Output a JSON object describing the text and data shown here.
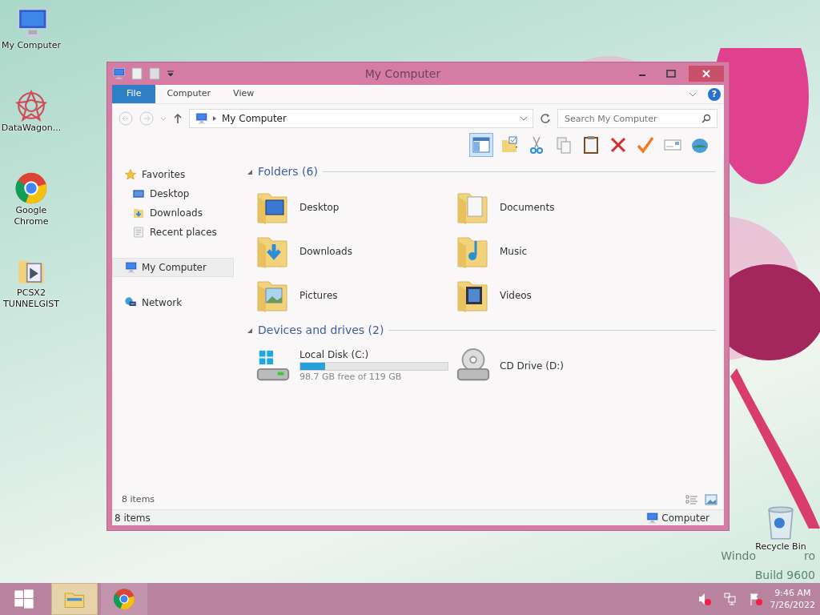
{
  "desktop_icons": [
    {
      "label": "My Computer",
      "kind": "computer"
    },
    {
      "label": "DataWagon...",
      "kind": "app"
    },
    {
      "label": "Google Chrome",
      "kind": "chrome"
    },
    {
      "label": "PCSX2 TUNNELGIST",
      "kind": "folder"
    }
  ],
  "recycle_bin": {
    "label": "Recycle Bin"
  },
  "os_watermark": {
    "line_1_left": "Windo",
    "line_1_right": "ro",
    "line_2": "Build 9600"
  },
  "window": {
    "title": "My Computer",
    "ribbon_tabs": [
      {
        "label": "File",
        "kind": "file"
      },
      {
        "label": "Computer",
        "kind": "tab"
      },
      {
        "label": "View",
        "kind": "tab"
      }
    ],
    "help_button": "?",
    "address": "My Computer",
    "search": {
      "placeholder": "Search My Computer"
    },
    "nav": [
      {
        "label": "Favorites",
        "kind": "star",
        "selected": false,
        "children": [
          {
            "label": "Desktop",
            "kind": "desktop",
            "selected": false
          },
          {
            "label": "Downloads",
            "kind": "downloads",
            "selected": false
          },
          {
            "label": "Recent places",
            "kind": "recent",
            "selected": false
          }
        ]
      },
      {
        "label": "My Computer",
        "kind": "computer",
        "selected": true
      },
      {
        "label": "Network",
        "kind": "network",
        "selected": false
      }
    ],
    "sections": [
      {
        "title": "Folders (6)",
        "items": [
          {
            "label": "Desktop",
            "kind": "desktop"
          },
          {
            "label": "Documents",
            "kind": "documents"
          },
          {
            "label": "Downloads",
            "kind": "downloads"
          },
          {
            "label": "Music",
            "kind": "music"
          },
          {
            "label": "Pictures",
            "kind": "pictures"
          },
          {
            "label": "Videos",
            "kind": "videos"
          }
        ]
      },
      {
        "title": "Devices and drives (2)",
        "items": [
          {
            "label": "Local Disk (C:)",
            "kind": "disk",
            "level": 0.17,
            "detail": "98.7 GB free of 119 GB"
          },
          {
            "label": "CD Drive (D:)",
            "kind": "cd"
          }
        ]
      }
    ],
    "footer_count": "8 items",
    "status_bar": {
      "left": "8 items",
      "right": "Computer"
    }
  },
  "taskbar": {
    "buttons": [
      {
        "kind": "start",
        "selected": false
      },
      {
        "kind": "explorer",
        "selected": true
      },
      {
        "kind": "chrome",
        "selected": false
      }
    ],
    "time": "9:46 AM",
    "date": "7/26/2022"
  }
}
